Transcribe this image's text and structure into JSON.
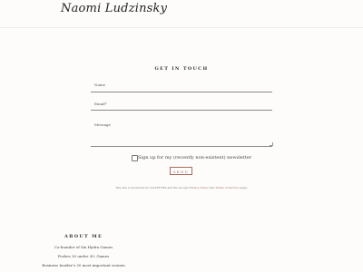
{
  "site": {
    "logo": "Naomi Ludzinsky"
  },
  "contact": {
    "heading": "GET IN TOUCH",
    "name_label": "Name",
    "email_label": "Email*",
    "message_label": "Message",
    "newsletter_label": "Sign up for my (recently non-existent) newsletter",
    "send_label": "SEND",
    "recaptcha": {
      "prefix": "This site is protected by reCAPTCHA and the Google ",
      "privacy": "Privacy Policy",
      "middle": " and ",
      "terms": "Terms of Service",
      "suffix": " apply."
    }
  },
  "about": {
    "heading": "ABOUT ME",
    "lines": [
      "Co-founder of Six Hydra Games",
      "Forbes 30 under 30: Games",
      "Business Insider's 30 most important women"
    ]
  },
  "colors": {
    "accent": "#a96c5c",
    "background": "#fdfcfa"
  }
}
